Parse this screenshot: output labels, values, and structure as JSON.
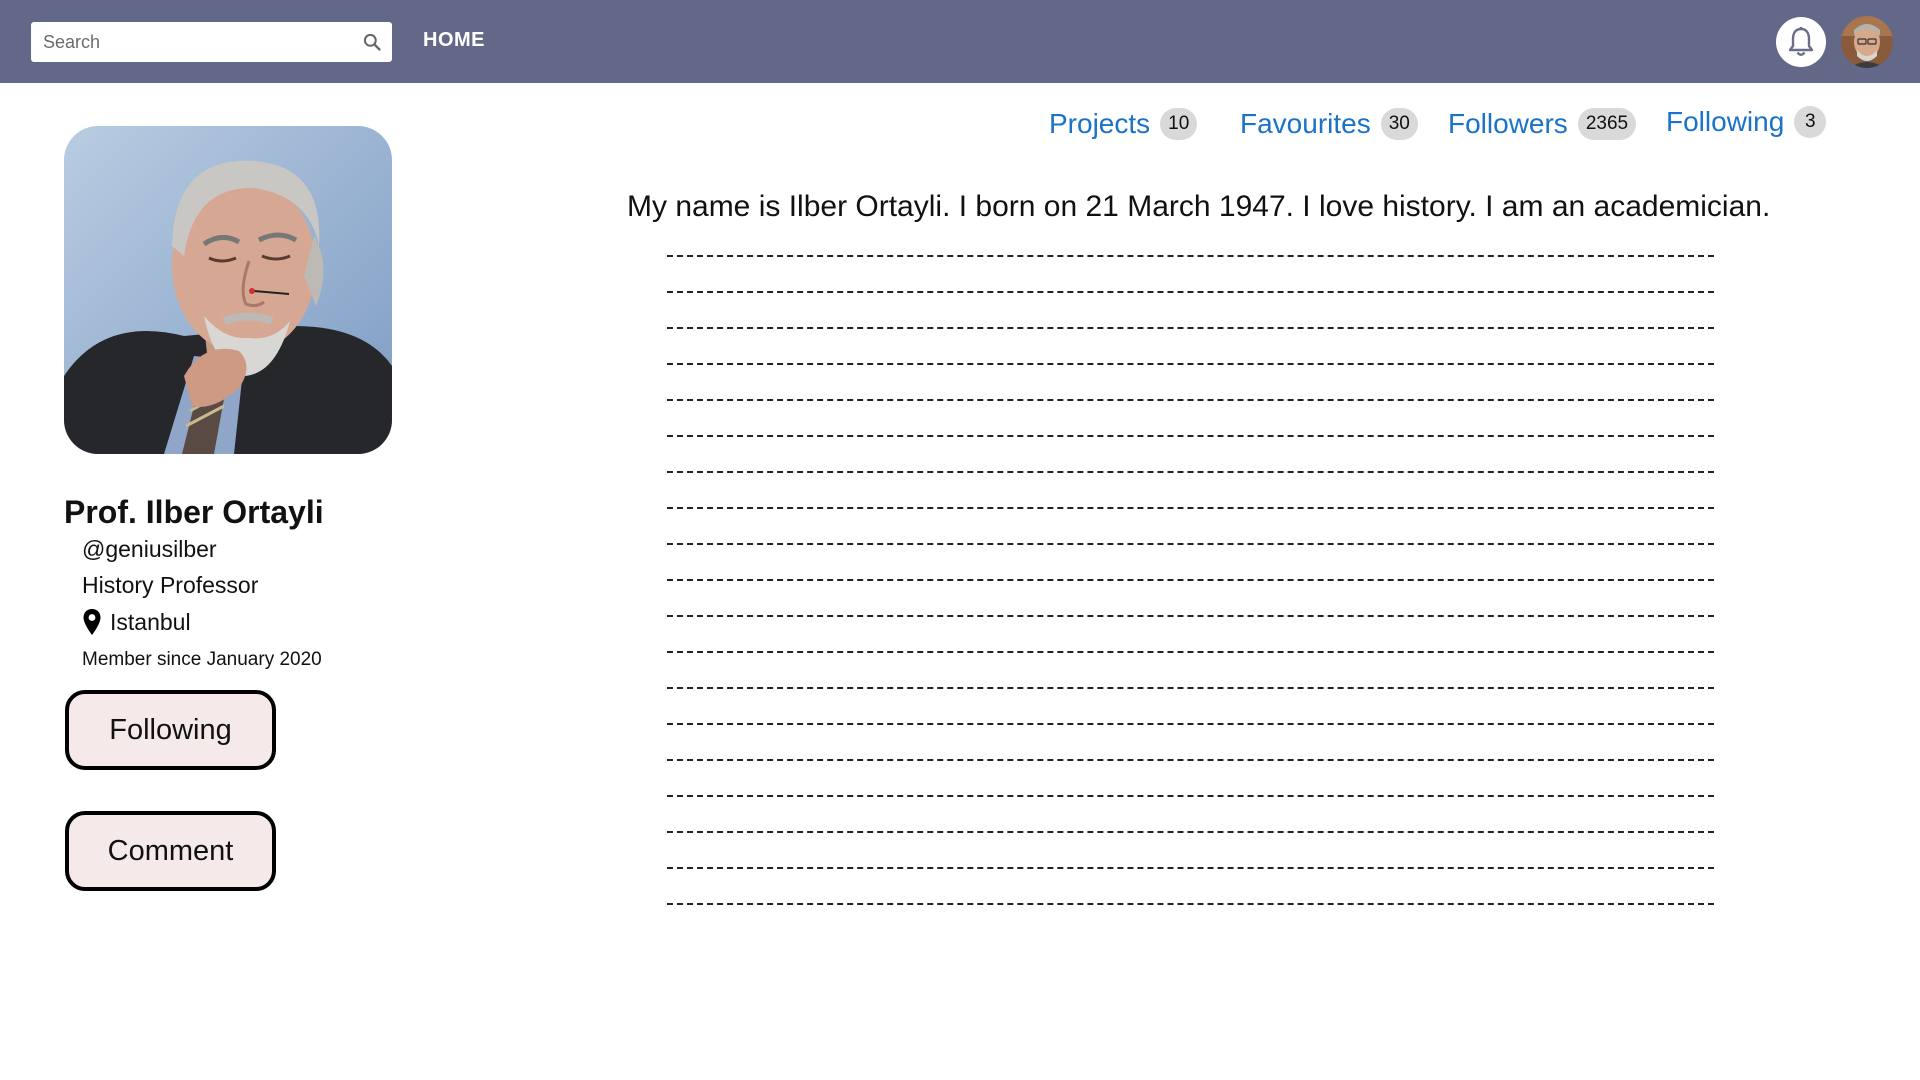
{
  "topbar": {
    "search_placeholder": "Search",
    "search_icon": "search-icon",
    "home_label": "HOME",
    "bell_icon": "bell-icon",
    "background": "#636888"
  },
  "profile": {
    "name": "Prof. Ilber Ortayli",
    "handle": "@geniusilber",
    "title": "History Professor",
    "location": "Istanbul",
    "member_since": "Member since January 2020",
    "following_button": "Following",
    "comment_button": "Comment"
  },
  "stats": [
    {
      "label": "Projects",
      "count": "10"
    },
    {
      "label": "Favourites",
      "count": "30"
    },
    {
      "label": "Followers",
      "count": "2365"
    },
    {
      "label": "Following",
      "count": "3"
    }
  ],
  "bio": {
    "text": "My name is Ilber Ortayli. I born on 21 March 1947. I love history. I am an academician.",
    "placeholder_line_count": 19
  },
  "colors": {
    "accent": "#1a73c8",
    "button_bg": "#f5e9ea",
    "count_badge": "#d9d9d9"
  }
}
